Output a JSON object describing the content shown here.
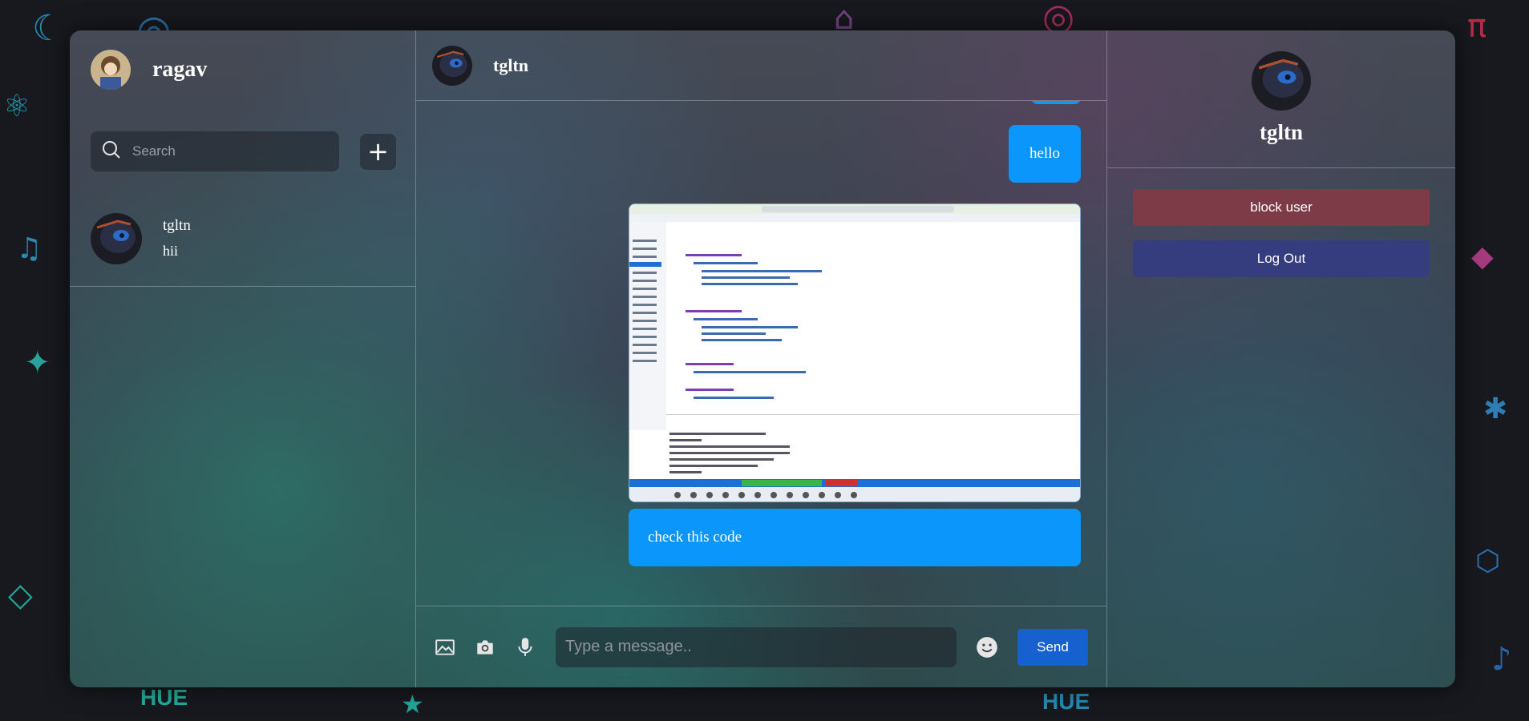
{
  "current_user": {
    "name": "ragav"
  },
  "search": {
    "placeholder": "Search"
  },
  "new_chat": {
    "label": "+"
  },
  "contacts": [
    {
      "name": "tgltn",
      "last_message": "hii"
    }
  ],
  "chat": {
    "contact_name": "tgltn",
    "messages": [
      {
        "type": "text",
        "text": "hello"
      },
      {
        "type": "image",
        "description": "code-screenshot"
      },
      {
        "type": "text",
        "text": "check this code"
      }
    ]
  },
  "composer": {
    "placeholder": "Type a message..",
    "send_label": "Send",
    "icons": [
      "image-icon",
      "camera-icon",
      "microphone-icon",
      "emoji-icon"
    ]
  },
  "details": {
    "name": "tgltn",
    "block_label": "block user",
    "logout_label": "Log Out"
  },
  "colors": {
    "bubble": "#0a96fb",
    "send": "#1660cf",
    "block": "#7c3b47",
    "logout": "#363d7e"
  }
}
